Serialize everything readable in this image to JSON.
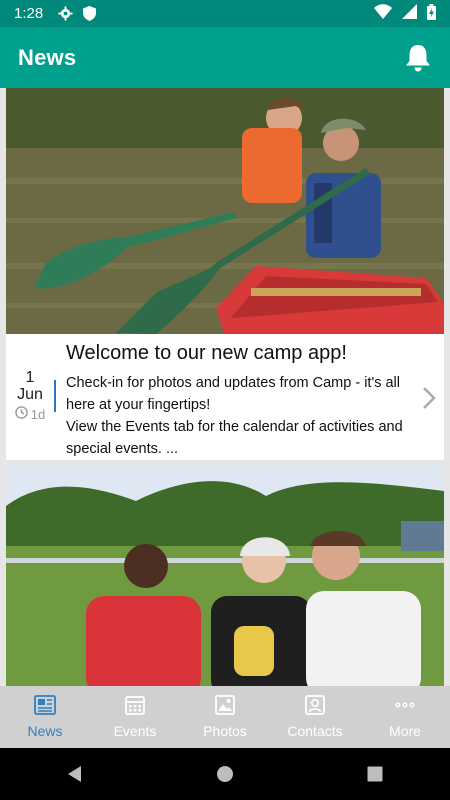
{
  "status_bar": {
    "time": "1:28",
    "icons": [
      "gear-icon",
      "shield-icon",
      "wifi-icon",
      "signal-icon",
      "battery-icon"
    ]
  },
  "app_bar": {
    "title": "News",
    "action_icon": "bell-icon"
  },
  "feed": {
    "items": [
      {
        "image": "camp-canoe-photo",
        "title": "Welcome to our new camp app!",
        "date_day": "1",
        "date_month": "Jun",
        "age": "1d",
        "summary": "Check-in for photos and updates from Camp - it's all here at your fingertips!\nView the Events tab for the calendar of activities and special events. ..."
      },
      {
        "image": "campers-smores-photo"
      }
    ]
  },
  "tabs": [
    {
      "label": "News",
      "icon": "newspaper-icon",
      "active": true
    },
    {
      "label": "Events",
      "icon": "calendar-icon",
      "active": false
    },
    {
      "label": "Photos",
      "icon": "photo-icon",
      "active": false
    },
    {
      "label": "Contacts",
      "icon": "contact-icon",
      "active": false
    },
    {
      "label": "More",
      "icon": "more-dots-icon",
      "active": false
    }
  ],
  "colors": {
    "status_bar": "#00897b",
    "app_bar": "#00a08c",
    "tab_active": "#2f7fc3",
    "tab_bar": "#d0d0d0"
  }
}
